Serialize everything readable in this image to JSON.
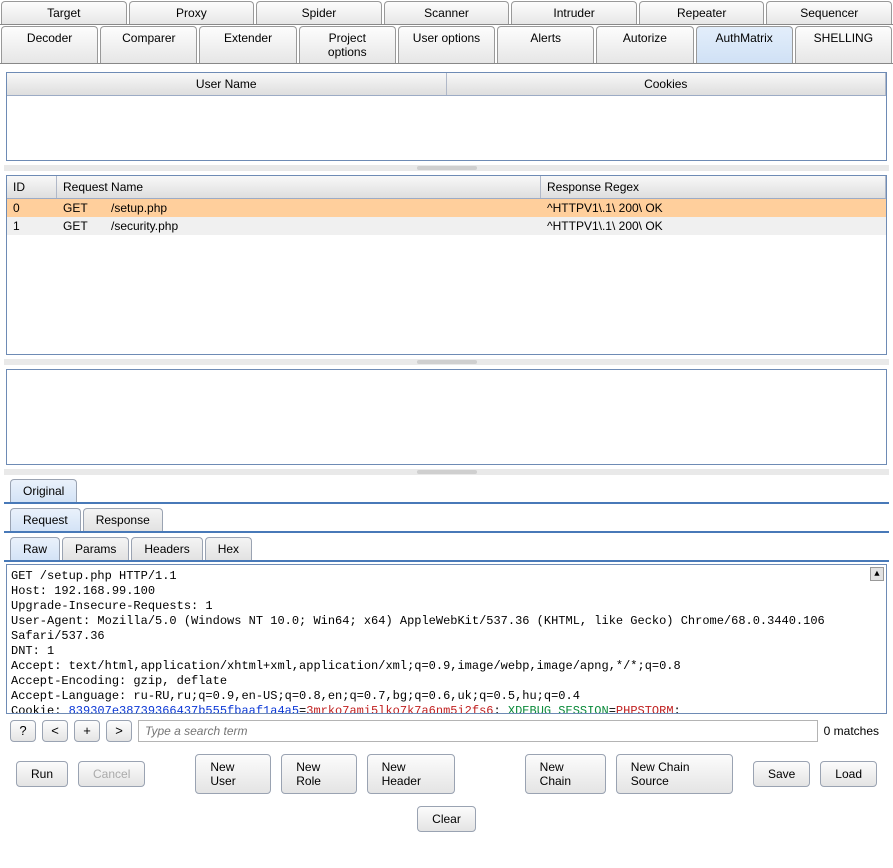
{
  "topTabs": [
    "Target",
    "Proxy",
    "Spider",
    "Scanner",
    "Intruder",
    "Repeater",
    "Sequencer"
  ],
  "secondTabs": [
    "Decoder",
    "Comparer",
    "Extender",
    "Project options",
    "User options",
    "Alerts",
    "Autorize",
    "AuthMatrix",
    "SHELLING"
  ],
  "secondActive": "AuthMatrix",
  "userCookieHeaders": {
    "user": "User Name",
    "cookies": "Cookies"
  },
  "requestTable": {
    "headers": {
      "id": "ID",
      "name": "Request Name",
      "regex": "Response Regex"
    },
    "rows": [
      {
        "id": "0",
        "method": "GET",
        "path": "/setup.php",
        "regex": "^HTTPV1\\.1\\ 200\\ OK",
        "selected": true
      },
      {
        "id": "1",
        "method": "GET",
        "path": "/security.php",
        "regex": "^HTTPV1\\.1\\ 200\\ OK",
        "selected": false
      }
    ]
  },
  "viewTabs": {
    "original": "Original"
  },
  "reqRespTabs": {
    "request": "Request",
    "response": "Response"
  },
  "rawTabs": {
    "raw": "Raw",
    "params": "Params",
    "headers": "Headers",
    "hex": "Hex"
  },
  "rawRequest": {
    "line1": "GET /setup.php HTTP/1.1",
    "host": "Host: 192.168.99.100",
    "uir": "Upgrade-Insecure-Requests: 1",
    "ua": "User-Agent: Mozilla/5.0 (Windows NT 10.0; Win64; x64) AppleWebKit/537.36 (KHTML, like Gecko) Chrome/68.0.3440.106 Safari/537.36",
    "dnt": "DNT: 1",
    "accept": "Accept: text/html,application/xhtml+xml,application/xml;q=0.9,image/webp,image/apng,*/*;q=0.8",
    "ae": "Accept-Encoding: gzip, deflate",
    "al": "Accept-Language: ru-RU,ru;q=0.9,en-US;q=0.8,en;q=0.7,bg;q=0.6,uk;q=0.5,hu;q=0.4",
    "cookieLabel": "Cookie: ",
    "cookieKey1": "839307e38739366437b555fbaaf1a4a5",
    "cookieEq": "=",
    "cookieVal1": "3mrko7ami5lko7k7a6nm5i2fs6",
    "cookieSep": "; ",
    "cookieKey2": "XDEBUG_SESSION",
    "cookieVal2": "PHPSTORM",
    "cookieEnd": ";"
  },
  "searchBar": {
    "help": "?",
    "prev": "<",
    "add": "+",
    "next": ">",
    "placeholder": "Type a search term",
    "matches": "0 matches"
  },
  "buttons": {
    "run": "Run",
    "cancel": "Cancel",
    "newUser": "New User",
    "newRole": "New Role",
    "newHeader": "New Header",
    "newChain": "New Chain",
    "newChainSource": "New Chain Source",
    "save": "Save",
    "load": "Load",
    "clear": "Clear"
  }
}
